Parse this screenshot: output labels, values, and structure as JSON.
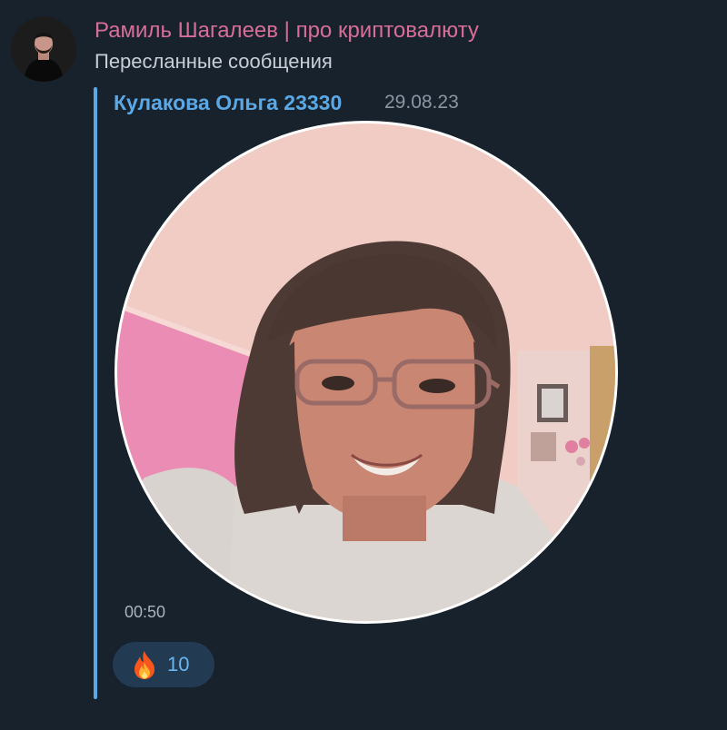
{
  "channel": {
    "title": "Рамиль Шагалеев | про криптовалюту",
    "subtitle": "Пересланные сообщения",
    "title_color": "#d86e98"
  },
  "forwarded": {
    "author": "Кулакова Ольга 23330",
    "date": "29.08.23",
    "accent_color": "#5aa9e6"
  },
  "video": {
    "duration": "00:50"
  },
  "reaction": {
    "emoji_icon": "fire-icon",
    "count": "10"
  }
}
